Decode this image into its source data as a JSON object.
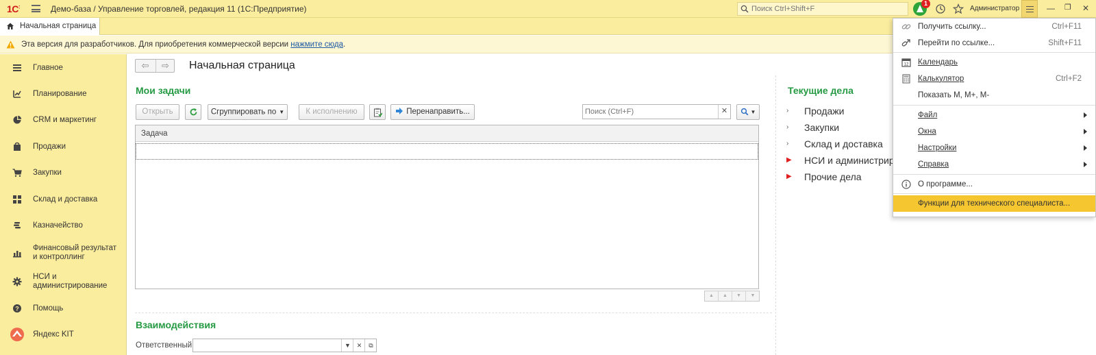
{
  "topbar": {
    "logo": "1С",
    "title": "Демо-база / Управление торговлей, редакция 11  (1С:Предприятие)",
    "search_placeholder": "Поиск Ctrl+Shift+F",
    "notification_count": "1",
    "user": "Администратор"
  },
  "tabs": {
    "home_label": "Начальная страница"
  },
  "warning": {
    "text": "Эта версия для разработчиков. Для приобретения коммерческой версии ",
    "link": "нажмите сюда",
    "suffix": "."
  },
  "sidebar": {
    "items": [
      {
        "label": "Главное",
        "icon": "list-icon"
      },
      {
        "label": "Планирование",
        "icon": "planning-icon"
      },
      {
        "label": "CRM и маркетинг",
        "icon": "pie-icon"
      },
      {
        "label": "Продажи",
        "icon": "bag-icon"
      },
      {
        "label": "Закупки",
        "icon": "cart-icon"
      },
      {
        "label": "Склад и доставка",
        "icon": "grid-icon"
      },
      {
        "label": "Казначейство",
        "icon": "coins-icon"
      },
      {
        "label": "Финансовый результат и контроллинг",
        "icon": "bars-icon"
      },
      {
        "label": "НСИ и администрирование",
        "icon": "gear-icon"
      },
      {
        "label": "Помощь",
        "icon": "help-icon"
      },
      {
        "label": "Яндекс KIT",
        "icon": "yandex-kit-icon"
      }
    ]
  },
  "main": {
    "title": "Начальная страница",
    "my_tasks": {
      "title": "Мои задачи",
      "buttons": {
        "open": "Открыть",
        "group_by": "Сгруппировать по",
        "to_execute": "К исполнению",
        "redirect": "Перенаправить..."
      },
      "search_placeholder": "Поиск (Ctrl+F)",
      "column": "Задача"
    },
    "interactions": {
      "title": "Взаимодействия",
      "responsible_label": "Ответственный:"
    },
    "current": {
      "title": "Текущие дела",
      "items": [
        {
          "label": "Продажи",
          "marker": "gray"
        },
        {
          "label": "Закупки",
          "marker": "gray"
        },
        {
          "label": "Склад и доставка",
          "marker": "gray"
        },
        {
          "label": "НСИ и администрирование",
          "marker": "red"
        },
        {
          "label": "Прочие дела",
          "marker": "red"
        }
      ]
    }
  },
  "menu": {
    "items": [
      {
        "label": "Получить ссылку...",
        "shortcut": "Ctrl+F11",
        "icon": "link-icon"
      },
      {
        "label": "Перейти по ссылке...",
        "shortcut": "Shift+F11",
        "icon": "follow-link-icon"
      },
      {
        "label": "Календарь",
        "shortcut": "",
        "icon": "calendar-icon"
      },
      {
        "label": "Калькулятор",
        "shortcut": "Ctrl+F2",
        "icon": "calculator-icon"
      },
      {
        "label": "Показать М, М+, М-",
        "shortcut": "",
        "icon": ""
      },
      {
        "label": "Файл",
        "shortcut": "",
        "icon": ""
      },
      {
        "label": "Окна",
        "shortcut": "",
        "icon": ""
      },
      {
        "label": "Настройки",
        "shortcut": "",
        "icon": ""
      },
      {
        "label": "Справка",
        "shortcut": "",
        "icon": ""
      },
      {
        "label": "О программе...",
        "shortcut": "",
        "icon": "info-icon"
      },
      {
        "label": "Функции для технического специалиста...",
        "shortcut": "",
        "icon": ""
      }
    ]
  },
  "colors": {
    "topbar_bg": "#fbed9e",
    "section_title": "#259a43",
    "menu_highlight": "#f5c630",
    "alert_red": "#e02020"
  }
}
